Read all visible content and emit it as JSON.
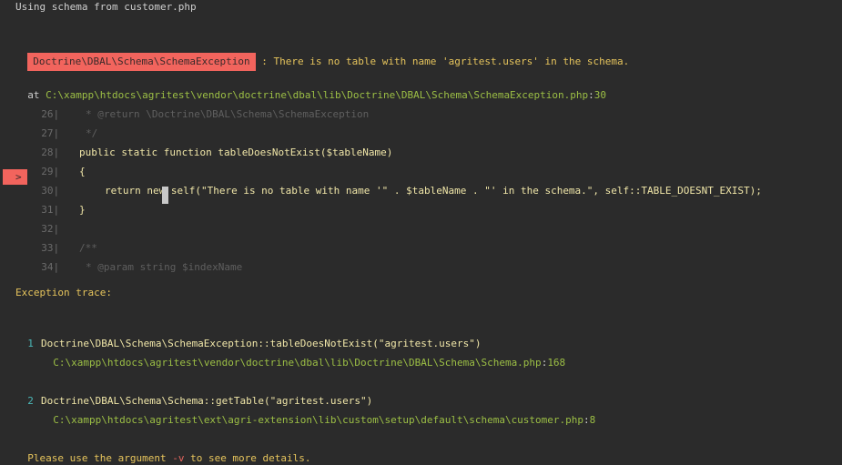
{
  "header": {
    "schema_note": "Using schema from customer.php"
  },
  "error": {
    "exception_class": "Doctrine\\DBAL\\Schema\\SchemaException",
    "message": " : There is no table with name 'agritest.users' in the schema."
  },
  "location": {
    "prefix": "at ",
    "path": "C:\\xampp\\htdocs\\agritest\\vendor\\doctrine\\dbal\\lib\\Doctrine\\DBAL\\Schema\\SchemaException.php",
    "colon": ":",
    "line": "30"
  },
  "code_lines": [
    {
      "no": "26",
      "text": "* @return \\Doctrine\\DBAL\\Schema\\SchemaException"
    },
    {
      "no": "27",
      "text": "*/"
    },
    {
      "no": "28",
      "text": "public static function tableDoesNotExist($tableName)"
    },
    {
      "no": "29",
      "text": "{"
    },
    {
      "no": "30",
      "text": "return new self(\"There is no table with name '\" . $tableName . \"' in the schema.\", self::TABLE_DOESNT_EXIST);"
    },
    {
      "no": "31",
      "text": "}"
    },
    {
      "no": "32",
      "text": ""
    },
    {
      "no": "33",
      "text": "/**"
    },
    {
      "no": "34",
      "text": "* @param string $indexName"
    }
  ],
  "current_marker": ">",
  "trace": {
    "heading": "Exception trace:",
    "items": [
      {
        "num": "1",
        "call": "Doctrine\\DBAL\\Schema\\SchemaException::tableDoesNotExist(\"agritest.users\")",
        "file": "C:\\xampp\\htdocs\\agritest\\vendor\\doctrine\\dbal\\lib\\Doctrine\\DBAL\\Schema\\Schema.php",
        "line": "168"
      },
      {
        "num": "2",
        "call": "Doctrine\\DBAL\\Schema\\Schema::getTable(\"agritest.users\")",
        "file": "C:\\xampp\\htdocs\\agritest\\ext\\agri-extension\\lib\\custom\\setup\\default\\schema\\customer.php",
        "line": "8"
      }
    ]
  },
  "footer": {
    "before": "Please use the argument ",
    "arg": "-v",
    "after": " to see more details."
  }
}
